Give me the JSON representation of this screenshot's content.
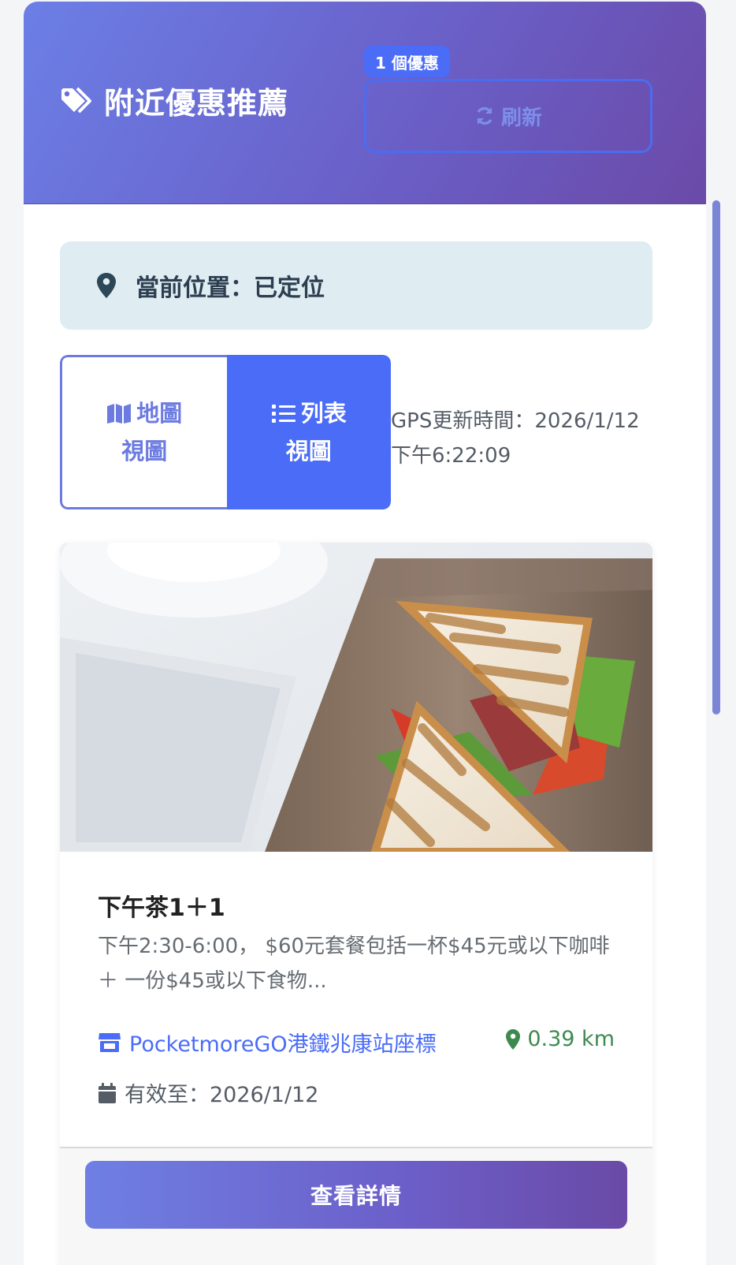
{
  "header": {
    "title": "附近優惠推薦",
    "badge": "1 個優惠",
    "refresh_label": "刷新"
  },
  "location": {
    "text": "當前位置：已定位"
  },
  "view_toggle": {
    "map_label": "地圖視圖",
    "list_label": "列表視圖",
    "active": "list"
  },
  "gps": {
    "text": "GPS更新時間：2026/1/12 下午6:22:09"
  },
  "offer": {
    "title": "下午茶1＋1",
    "description": "下午2:30-6:00， $60元套餐包括一杯$45元或以下咖啡 ＋ 一份$45或以下食物...",
    "store": "PocketmoreGO港鐵兆康站座標",
    "distance": "0.39 km",
    "valid_until": "有效至：2026/1/12",
    "detail_button": "查看詳情"
  },
  "colors": {
    "header_start": "#6b7fe6",
    "header_end": "#6b4aa8",
    "accent": "#4a6cf7",
    "distance": "#3d8a4f"
  },
  "icons": {
    "title": "tags-icon",
    "refresh": "sync-icon",
    "location": "map-marker-icon",
    "map_view": "map-icon",
    "list_view": "list-icon",
    "store": "store-icon",
    "distance": "map-marker-icon",
    "valid": "calendar-icon"
  }
}
